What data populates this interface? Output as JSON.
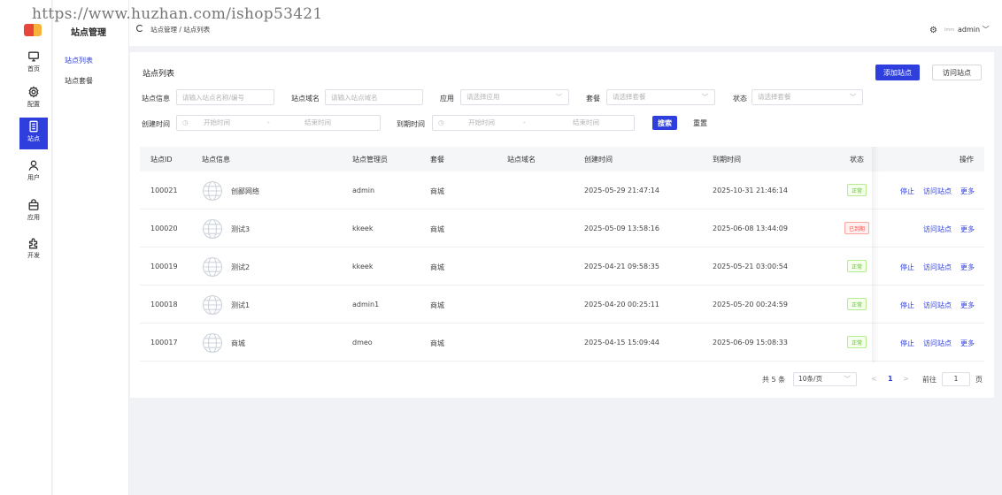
{
  "watermark": "https://www.huzhan.com/ishop53421",
  "rail": {
    "items": [
      {
        "label": "首页",
        "icon": "monitor-icon"
      },
      {
        "label": "配置",
        "icon": "gear-icon"
      },
      {
        "label": "站点",
        "icon": "document-icon"
      },
      {
        "label": "用户",
        "icon": "user-icon"
      },
      {
        "label": "应用",
        "icon": "bag-icon"
      },
      {
        "label": "开发",
        "icon": "puzzle-icon"
      }
    ],
    "active": "站点"
  },
  "subnav": {
    "title": "站点管理",
    "items": [
      "站点列表",
      "站点套餐"
    ]
  },
  "topbar": {
    "breadcrumb": "站点管理 / 站点列表",
    "avatar_text": "lmm",
    "username": "admin",
    "user_chevron": "﹀"
  },
  "page": {
    "heading": "站点列表",
    "add_site": "添加站点",
    "visit_site": "访问站点"
  },
  "filters": {
    "site_info_label": "站点信息",
    "site_info_placeholder": "请输入站点名称/编号",
    "site_domain_label": "站点域名",
    "site_domain_placeholder": "请输入站点域名",
    "app_label": "应用",
    "app_placeholder": "请选择应用",
    "package_label": "套餐",
    "package_placeholder": "请选择套餐",
    "status_label": "状态",
    "status_placeholder": "请选择套餐",
    "create_time_label": "创建时间",
    "expire_time_label": "到期时间",
    "start_placeholder": "开始时间",
    "range_sep": "-",
    "end_placeholder": "结束时间",
    "search": "搜索",
    "reset": "重置"
  },
  "table": {
    "columns": [
      "站点ID",
      "站点信息",
      "站点管理员",
      "套餐",
      "站点域名",
      "创建时间",
      "到期时间",
      "状态",
      "操作"
    ],
    "rows": [
      {
        "id": "100021",
        "name": "创鄙网络",
        "admin": "admin",
        "package": "商城",
        "domain": "",
        "created": "2025-05-29 21:47:14",
        "expires": "2025-10-31 21:46:14",
        "status": "正常",
        "status_type": "ok",
        "stop": "停止",
        "visit": "访问站点",
        "more": "更多"
      },
      {
        "id": "100020",
        "name": "测试3",
        "admin": "kkeek",
        "package": "商城",
        "domain": "",
        "created": "2025-05-09 13:58:16",
        "expires": "2025-06-08 13:44:09",
        "status": "已到期",
        "status_type": "exp",
        "stop": "",
        "visit": "访问站点",
        "more": "更多"
      },
      {
        "id": "100019",
        "name": "测试2",
        "admin": "kkeek",
        "package": "商城",
        "domain": "",
        "created": "2025-04-21 09:58:35",
        "expires": "2025-05-21 03:00:54",
        "status": "正常",
        "status_type": "ok",
        "stop": "停止",
        "visit": "访问站点",
        "more": "更多"
      },
      {
        "id": "100018",
        "name": "测试1",
        "admin": "admin1",
        "package": "商城",
        "domain": "",
        "created": "2025-04-20 00:25:11",
        "expires": "2025-05-20 00:24:59",
        "status": "正常",
        "status_type": "ok",
        "stop": "停止",
        "visit": "访问站点",
        "more": "更多"
      },
      {
        "id": "100017",
        "name": "商城",
        "admin": "dmeo",
        "package": "商城",
        "domain": "",
        "created": "2025-04-15 15:09:44",
        "expires": "2025-06-09 15:08:33",
        "status": "正常",
        "status_type": "ok",
        "stop": "停止",
        "visit": "访问站点",
        "more": "更多"
      }
    ]
  },
  "pagination": {
    "total": "共 5 条",
    "page_size": "10条/页",
    "prev": "<",
    "current": "1",
    "next": ">",
    "goto_label": "前往",
    "goto_value": "1",
    "page_unit": "页"
  },
  "colors": {
    "primary": "#2f3fdd",
    "ok": "#52c41a",
    "expired": "#ff4d4f"
  }
}
